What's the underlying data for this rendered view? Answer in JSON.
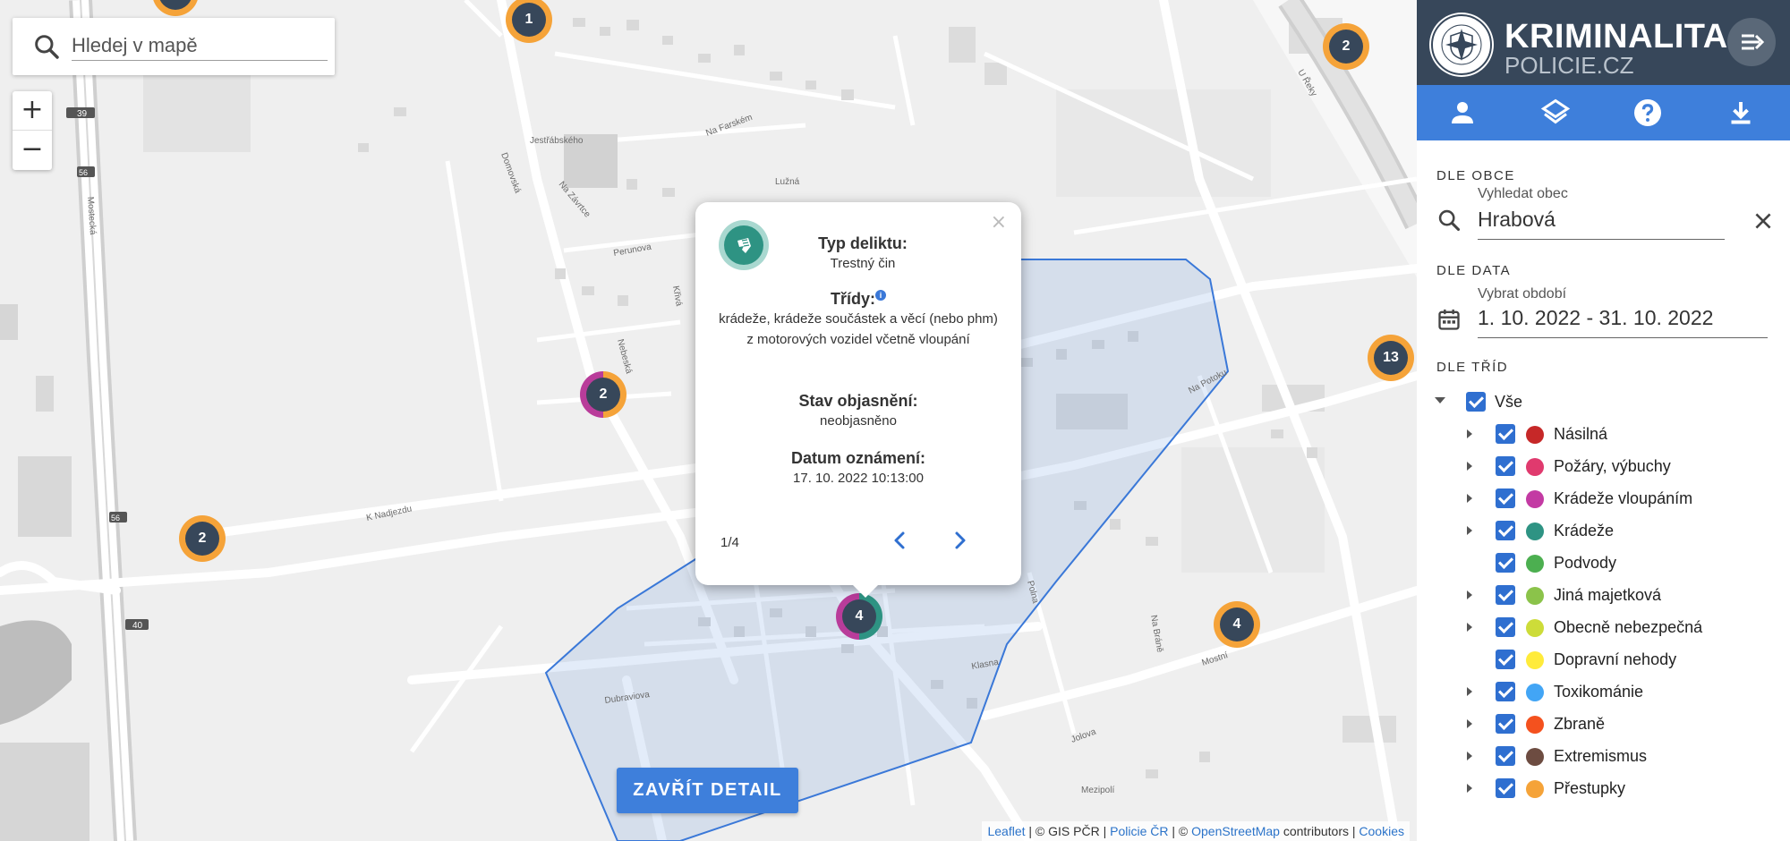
{
  "search": {
    "placeholder": "Hledej v mapě"
  },
  "zoom": {
    "in": "+",
    "out": "−"
  },
  "map": {
    "roads": [
      "Jestřábského",
      "Na Farském",
      "Lužná",
      "Na Závrtce",
      "Perunova",
      "Křivá",
      "Nebeská",
      "Domovská",
      "K Nadjezdu",
      "Dubraviova",
      "Klasna",
      "Na Potoku",
      "Mostní",
      "Mezipolí",
      "Jolova",
      "U Řeky",
      "Mostecká",
      "Polna",
      "Na Bráně"
    ],
    "route_shields": [
      "39",
      "56",
      "56",
      "40"
    ]
  },
  "clusters": [
    {
      "count": "1",
      "colors": [
        "#f5a339"
      ]
    },
    {
      "count": "2",
      "colors": [
        "#f5a339"
      ]
    },
    {
      "count": "2",
      "colors": [
        "#f5a339",
        "#b93c9a"
      ]
    },
    {
      "count": "13",
      "colors": [
        "#f5a339"
      ]
    },
    {
      "count": "2",
      "colors": [
        "#f5a339"
      ]
    },
    {
      "count": "4",
      "colors": [
        "#2e9383",
        "#b93c9a"
      ]
    },
    {
      "count": "4",
      "colors": [
        "#f5a339"
      ]
    },
    {
      "count": "",
      "colors": [
        "#f5a339"
      ]
    }
  ],
  "popup": {
    "type_label": "Typ deliktu:",
    "type_value": "Trestný čin",
    "classes_label": "Třídy:",
    "classes_value": "krádeže, krádeže součástek a věcí (nebo phm) z motorových vozidel včetně vloupání",
    "status_label": "Stav objasnění:",
    "status_value": "neobjasněno",
    "date_label": "Datum oznámení:",
    "date_value": "17. 10. 2022 10:13:00",
    "counter": "1/4",
    "close": "×",
    "info": "i"
  },
  "close_detail": "ZAVŘÍT DETAIL",
  "attribution": {
    "leaflet": "Leaflet",
    "gis": " | © GIS PČR | ",
    "policie": "Policie ČR",
    "sep": " | © ",
    "osm": "OpenStreetMap",
    "contrib": " contributors | ",
    "cookies": "Cookies"
  },
  "sidebar": {
    "title": "KRIMINALITA",
    "subtitle": "POLICIE.CZ",
    "municipality": {
      "section": "DLE OBCE",
      "label": "Vyhledat obec",
      "value": "Hrabová"
    },
    "date": {
      "section": "DLE DATA",
      "label": "Vybrat období",
      "value": "1. 10. 2022 - 31. 10. 2022"
    },
    "classes": {
      "section": "DLE TŘÍD",
      "all": "Vše",
      "items": [
        {
          "label": "Násilná",
          "color": "#c62828",
          "expandable": true
        },
        {
          "label": "Požáry, výbuchy",
          "color": "#e03a6e",
          "expandable": true
        },
        {
          "label": "Krádeže vloupáním",
          "color": "#c33aa3",
          "expandable": true
        },
        {
          "label": "Krádeže",
          "color": "#2e9383",
          "expandable": true
        },
        {
          "label": "Podvody",
          "color": "#4caf50",
          "expandable": false
        },
        {
          "label": "Jiná majetková",
          "color": "#8bc34a",
          "expandable": true
        },
        {
          "label": "Obecně nebezpečná",
          "color": "#cddc39",
          "expandable": true
        },
        {
          "label": "Dopravní nehody",
          "color": "#ffeb3b",
          "expandable": false
        },
        {
          "label": "Toxikománie",
          "color": "#42a5f5",
          "expandable": true
        },
        {
          "label": "Zbraně",
          "color": "#f4511e",
          "expandable": true
        },
        {
          "label": "Extremismus",
          "color": "#6d4c41",
          "expandable": true
        },
        {
          "label": "Přestupky",
          "color": "#f5a339",
          "expandable": true
        }
      ]
    }
  },
  "colors": {
    "accent": "#3e7fdb",
    "header": "#37475a",
    "polygon": "#3a78d8"
  }
}
